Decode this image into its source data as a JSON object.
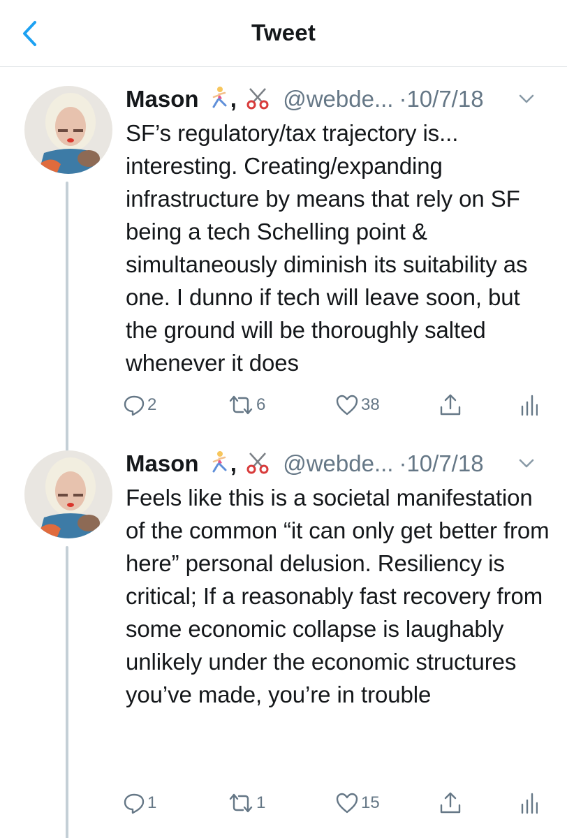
{
  "nav": {
    "title": "Tweet",
    "back_icon": "chevron-left-icon"
  },
  "colors": {
    "accent": "#1da1f2",
    "secondary_text": "#657786",
    "thread_line": "#c4cfd6",
    "divider": "#dfe3e6"
  },
  "tweets": [
    {
      "author_name": "Mason",
      "emojis": [
        "woman-running-icon",
        "scissors-icon"
      ],
      "handle": "@webde...",
      "separator": "·",
      "date": "10/7/18",
      "text": "SF’s regulatory/tax trajectory is... interesting. Creating/expanding infrastructure by means that rely on SF being a tech Schelling point & simultaneously diminish its suitability as one. I dunno if tech will leave soon, but the ground will be thoroughly salted whenever it does",
      "replies": "2",
      "retweets": "6",
      "likes": "38"
    },
    {
      "author_name": "Mason",
      "emojis": [
        "woman-running-icon",
        "scissors-icon"
      ],
      "handle": "@webde...",
      "separator": "·",
      "date": "10/7/18",
      "text": "Feels like this is a societal manifestation of the common “it can only get better from here” personal delusion. Resiliency is critical; If a reasonably fast recovery from some economic collapse is laughably unlikely under the economic structures you’ve made, you’re in trouble",
      "replies": "1",
      "retweets": "1",
      "likes": "15"
    }
  ]
}
